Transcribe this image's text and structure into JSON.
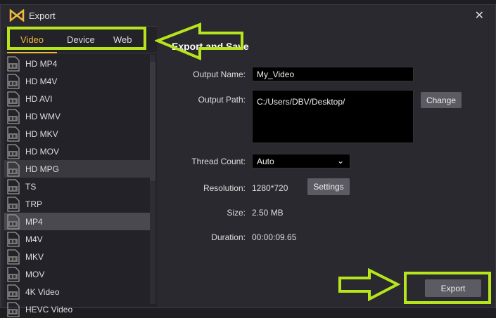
{
  "window": {
    "title": "Export",
    "close": "✕"
  },
  "tabs": [
    "Video",
    "Device",
    "Web"
  ],
  "formats": [
    "HD MP4",
    "HD M4V",
    "HD AVI",
    "HD WMV",
    "HD MKV",
    "HD MOV",
    "HD MPG",
    "TS",
    "TRP",
    "MP4",
    "M4V",
    "MKV",
    "MOV",
    "4K Video",
    "HEVC Video"
  ],
  "selected_format": "MP4",
  "main": {
    "heading": "Export and Save",
    "output_name_label": "Output Name:",
    "output_name": "My_Video",
    "output_path_label": "Output Path:",
    "output_path": "C:/Users/DBV/Desktop/",
    "change_label": "Change",
    "thread_label": "Thread Count:",
    "thread_value": "Auto",
    "resolution_label": "Resolution:",
    "resolution": "1280*720",
    "settings_label": "Settings",
    "size_label": "Size:",
    "size": "2.50 MB",
    "duration_label": "Duration:",
    "duration": "00:00:09.65",
    "export_label": "Export"
  },
  "colors": {
    "accent": "#f0b93a",
    "annotation": "#b6e51c"
  }
}
